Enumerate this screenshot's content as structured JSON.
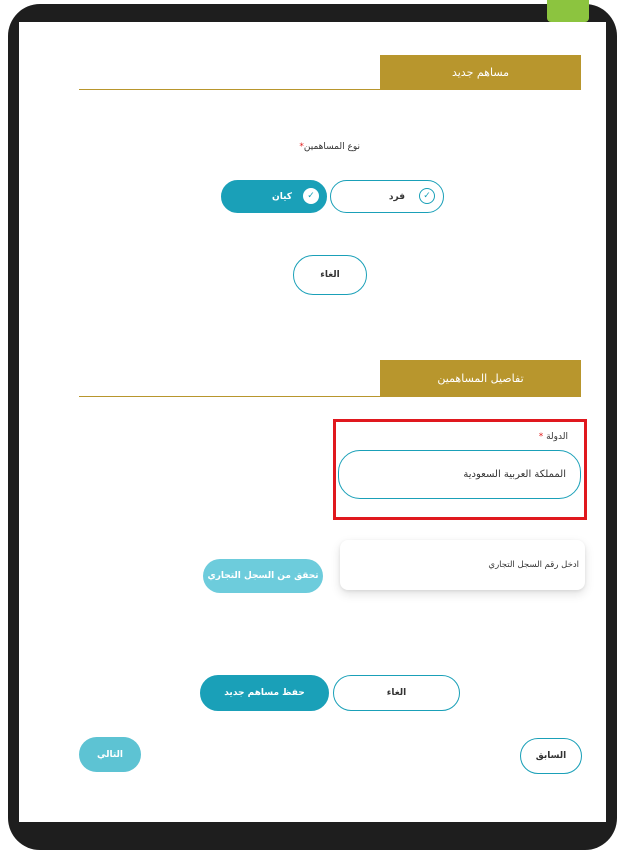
{
  "new_shareholder": {
    "header": "مساهم جديد",
    "type_label": "نوع المساهمين",
    "required_mark": "*",
    "options": [
      {
        "label": "فرد",
        "selected": false
      },
      {
        "label": "كيان",
        "selected": true
      }
    ],
    "cancel_label": "الغاء"
  },
  "shareholder_details": {
    "header": "تفاصيل المساهمين",
    "country_label": "الدولة",
    "required_mark": "*",
    "country_value": "المملكة العربية السعودية",
    "cr_placeholder": "ادخل رقم السجل التجاري",
    "verify_label": "تحقق من السجل التجاري"
  },
  "form_actions": {
    "cancel_label": "الغاء",
    "save_label": "حفظ مساهم جديد"
  },
  "navigation": {
    "previous_label": "السابق",
    "next_label": "التالي"
  },
  "colors": {
    "gold": "#b8962d",
    "teal": "#1aa0b8",
    "teal_light": "#6dccdc",
    "highlight_red": "#e0181e",
    "frame": "#1e1e1e",
    "corner_green": "#8cc43f"
  },
  "icons": {
    "check": "check-circle-icon"
  }
}
